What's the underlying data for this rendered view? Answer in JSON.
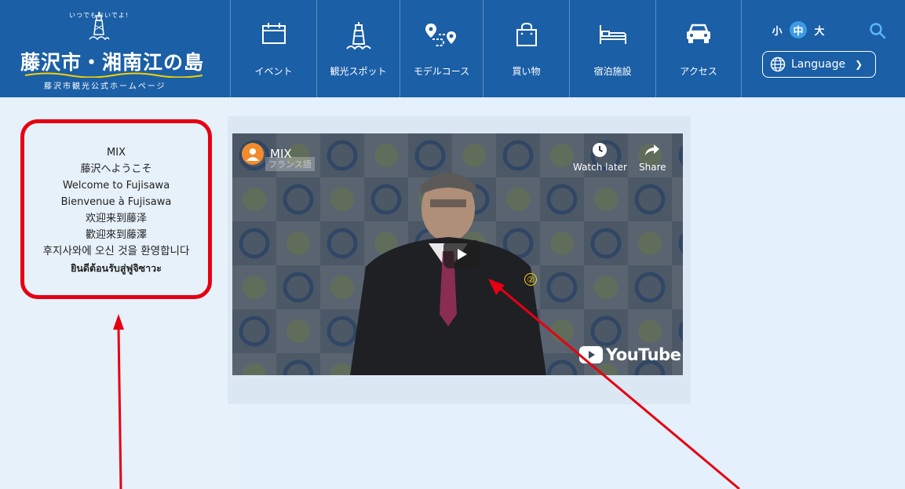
{
  "header": {
    "logo_tagline_curved": "いつでもおいでよ!",
    "logo_title": "藤沢市・湘南江の島",
    "logo_subtitle": "藤沢市観光公式ホームページ",
    "nav": [
      {
        "label": "イベント",
        "icon": "calendar-icon"
      },
      {
        "label": "観光スポット",
        "icon": "lighthouse-icon"
      },
      {
        "label": "モデルコース",
        "icon": "route-icon"
      },
      {
        "label": "買い物",
        "icon": "shopping-bag-icon"
      },
      {
        "label": "宿泊施設",
        "icon": "bed-icon"
      },
      {
        "label": "アクセス",
        "icon": "car-icon"
      }
    ],
    "font_size": {
      "small": "小",
      "medium": "中",
      "large": "大",
      "selected": "中"
    },
    "language_button": "Language"
  },
  "greeting": {
    "lines": [
      "MIX",
      "藤沢へようこそ",
      "Welcome to Fujisawa",
      "Bienvenue à Fujisawa",
      "欢迎来到藤泽",
      "歡迎來到藤澤",
      "후지사와에 오신 것을 환영합니다",
      "ยินดีต้อนรับสู่ฟูจิซาวะ"
    ]
  },
  "video": {
    "channel": "MIX",
    "subtitle_tag": "フランス語",
    "watch_later": "Watch later",
    "share": "Share",
    "marker": "②",
    "platform": "YouTube"
  },
  "colors": {
    "header_bg": "#1b5fa6",
    "page_bg": "#e4f0fb",
    "annotation_red": "#e60012",
    "marker_yellow": "#ffd400"
  }
}
